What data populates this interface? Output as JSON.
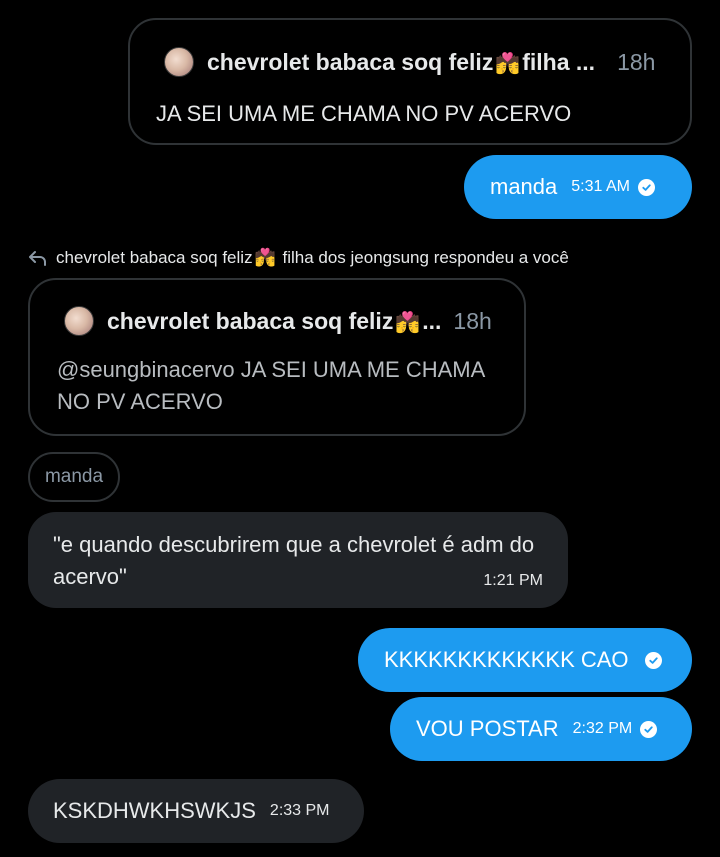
{
  "quote1": {
    "author": "chevrolet babaca soq feliz",
    "author_suffix": "filha ...",
    "emoji": "💏",
    "time": "18h",
    "text": "JA SEI UMA ME CHAMA NO PV ACERVO"
  },
  "msg_manda": {
    "text": "manda",
    "time": "5:31 AM"
  },
  "reply_notice": {
    "author": "chevrolet babaca soq feliz",
    "emoji": "💏",
    "text": "filha dos jeongsung respondeu a você"
  },
  "quote2": {
    "author": "chevrolet babaca soq feliz",
    "ellipsis": "...",
    "emoji": "💏",
    "time": "18h",
    "text": "@seungbinacervo JA SEI UMA ME CHAMA NO PV ACERVO"
  },
  "chip": {
    "text": "manda"
  },
  "msg_incoming1": {
    "text": "\"e quando descubrirem que a chevrolet é adm do acervo\"",
    "time": "1:21 PM"
  },
  "msg_k": {
    "text": "KKKKKKKKKKKKK CAO"
  },
  "msg_vou": {
    "text": "VOU POSTAR",
    "time": "2:32 PM"
  },
  "msg_ksk": {
    "text": "KSKDHWKHSWKJS",
    "time": "2:33 PM"
  },
  "colors": {
    "outgoing": "#1d9bf0",
    "incoming": "#202327",
    "border": "#2f3336",
    "muted": "#8b98a5"
  }
}
